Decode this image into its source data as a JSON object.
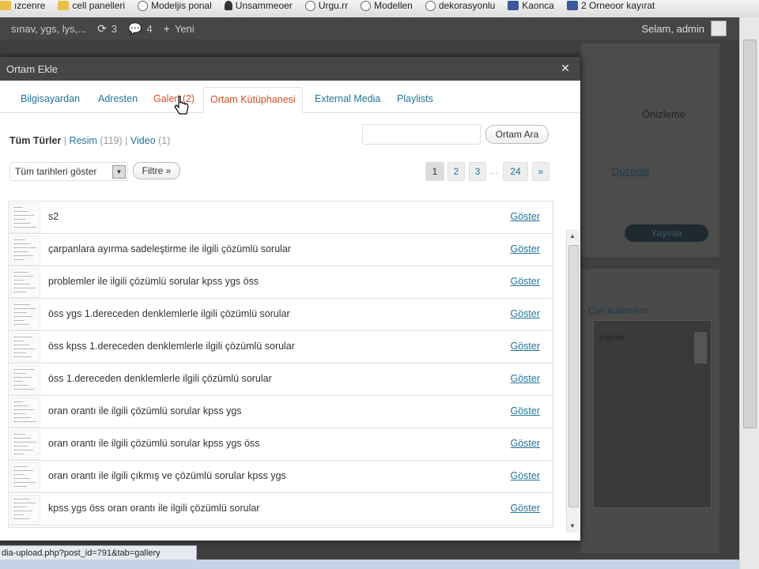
{
  "browser": {
    "bookmarks": [
      {
        "label": "ızcenre",
        "icon": "folder-icon"
      },
      {
        "label": "cell panelleri",
        "icon": "folder-icon"
      },
      {
        "label": "Modeljis ponal",
        "icon": "globe-icon"
      },
      {
        "label": "Unsammeoer",
        "icon": "person-icon"
      },
      {
        "label": "Urgu.rr",
        "icon": "globe-icon"
      },
      {
        "label": "Modellen",
        "icon": "globe-icon"
      },
      {
        "label": "dekorasyonlu",
        "icon": "globe-icon"
      },
      {
        "label": "Kaonca",
        "icon": "facebook-icon"
      },
      {
        "label": "2 Orneoor kayırat",
        "icon": "facebook-icon"
      }
    ],
    "status_url": "dia-upload.php?post_id=791&tab=gallery"
  },
  "adminbar": {
    "site": "sınav, ygs, lys,...",
    "updates": "3",
    "comments": "4",
    "new": "Yeni",
    "greeting": "Selam, admin"
  },
  "background": {
    "preview": "Önizleme",
    "update_button": "Yayınla",
    "link1": "Düzenle",
    "link2": "Çok kullanılan",
    "side_text": "elerler"
  },
  "modal": {
    "title": "Ortam Ekle",
    "tabs": [
      {
        "label": "Bilgisayardan"
      },
      {
        "label": "Adresten"
      },
      {
        "label": "Galeri (2)"
      },
      {
        "label": "Ortam Kütüphanesi"
      },
      {
        "label": "External Media"
      },
      {
        "label": "Playlists"
      }
    ],
    "filters": {
      "all": "Tüm Türler",
      "sep": "|",
      "image_label": "Resim",
      "image_count": "(119)",
      "video_label": "Video",
      "video_count": "(1)"
    },
    "search_button": "Ortam Ara",
    "search_value": "",
    "date_select": "Tüm tarihleri göster",
    "filter_button": "Filtre »",
    "pagination": {
      "pages": [
        "1",
        "2",
        "3"
      ],
      "ellipsis": "…",
      "last": "24",
      "next": "»",
      "current": "1"
    },
    "show_label": "Göster",
    "items": [
      {
        "title": "s2"
      },
      {
        "title": "çarpanlara ayırma sadeleştirme ile ilgili çözümlü sorular"
      },
      {
        "title": "problemler ile ilgili çözümlü sorular kpss ygs öss"
      },
      {
        "title": "öss ygs 1.dereceden denklemlerle ilgili çözümlü sorular"
      },
      {
        "title": "öss kpss 1.dereceden denklemlerle ilgili çözümlü sorular"
      },
      {
        "title": "öss 1.dereceden denklemlerle ilgili çözümlü sorular"
      },
      {
        "title": "oran orantı ile ilgili çözümlü sorular kpss ygs"
      },
      {
        "title": "oran orantı ile ilgili çözümlü sorular kpss ygs öss"
      },
      {
        "title": "oran orantı ile ilgili çıkmış ve çözümlü sorular kpss ygs"
      },
      {
        "title": "kpss ygs öss oran orantı ile ilgili çözümlü sorular"
      }
    ]
  }
}
